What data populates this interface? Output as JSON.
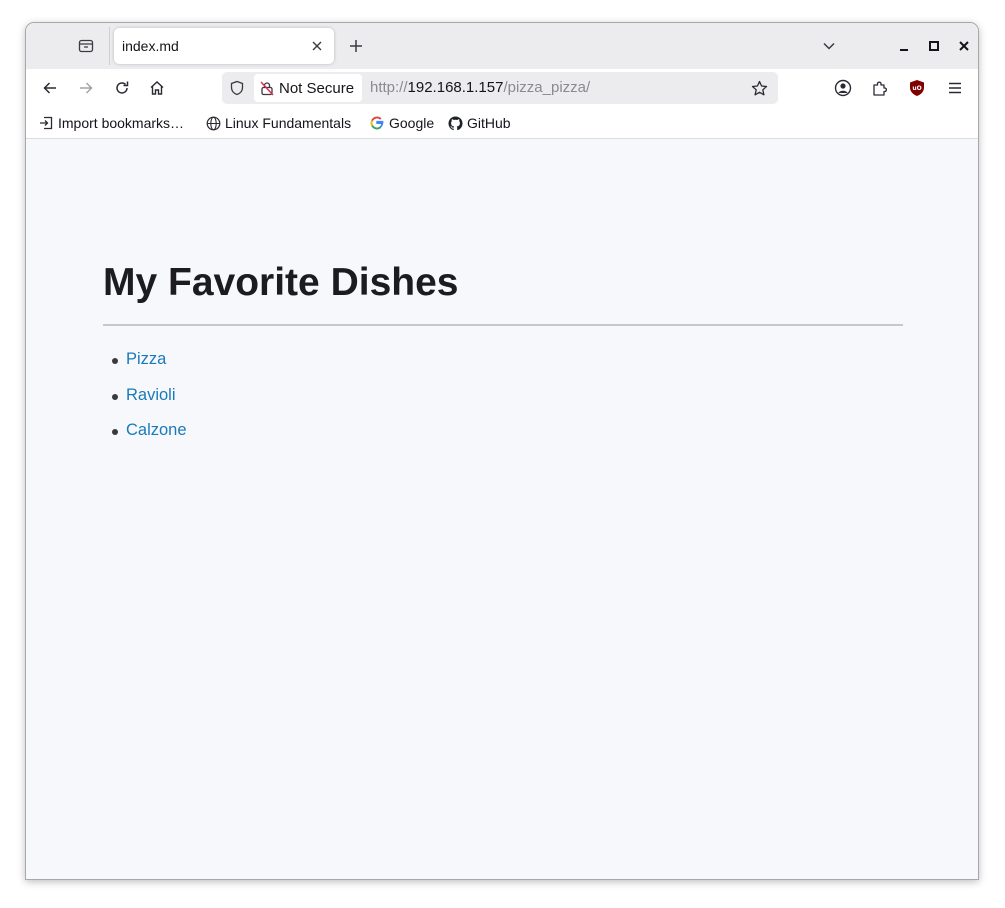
{
  "browser": {
    "tab": {
      "title": "index.md"
    },
    "address_bar": {
      "security_label": "Not Secure",
      "url_scheme": "http://",
      "url_host": "192.168.1.157",
      "url_path": "/pizza_pizza/"
    },
    "bookmarks": [
      {
        "label": "Import bookmarks…",
        "icon": "import-icon"
      },
      {
        "label": "Linux Fundamentals",
        "icon": "globe-icon"
      },
      {
        "label": "Google",
        "icon": "google-icon"
      },
      {
        "label": "GitHub",
        "icon": "github-icon"
      }
    ],
    "colors": {
      "link": "#1a7ab8",
      "tabstrip": "#ececef",
      "page_bg": "#f7f8fc",
      "ublock": "#800000"
    }
  },
  "page": {
    "heading": "My Favorite Dishes",
    "dishes": [
      "Pizza",
      "Ravioli",
      "Calzone"
    ]
  }
}
